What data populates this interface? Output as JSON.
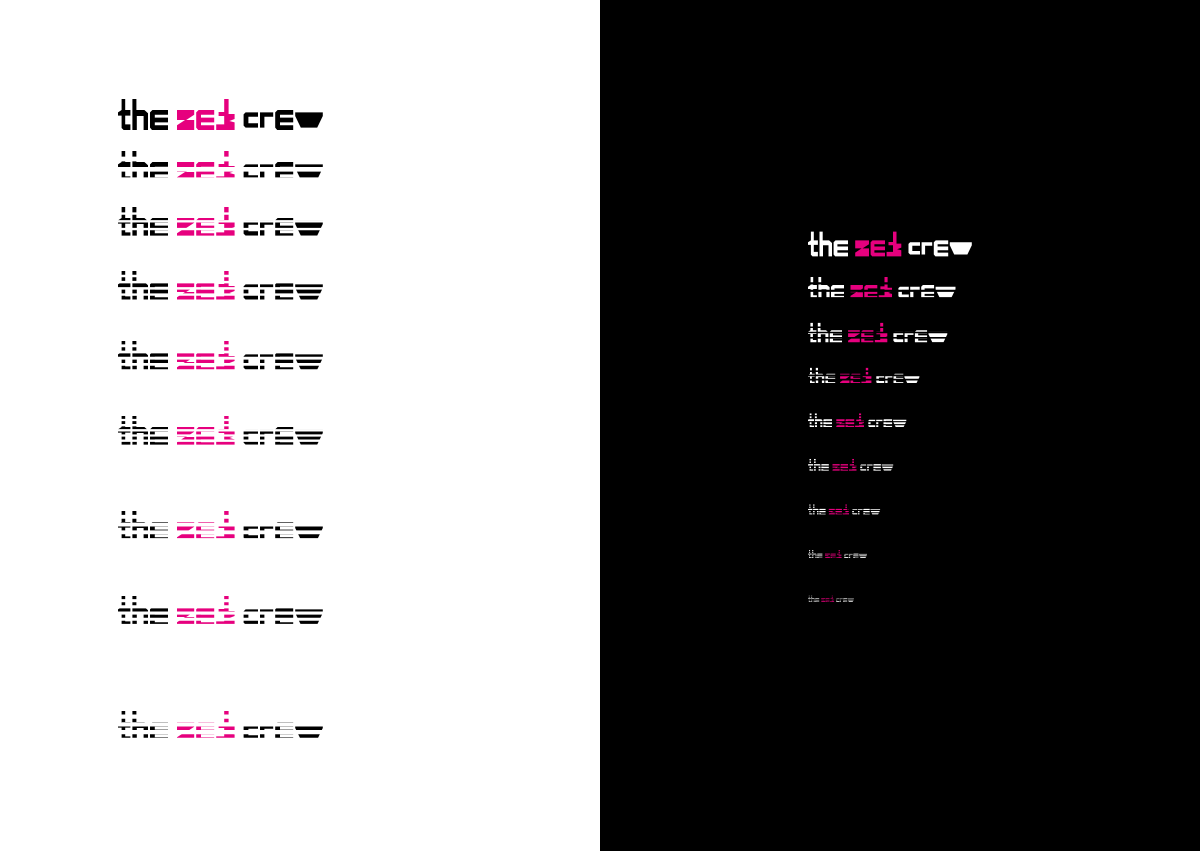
{
  "wordmark": {
    "words": [
      "the",
      "zek",
      "crew"
    ],
    "accent_word_index": 1
  },
  "colors": {
    "left_background": "#ffffff",
    "left_ink": "#000000",
    "right_background": "#000000",
    "right_ink": "#ffffff",
    "accent": "#e6007e"
  },
  "left_sequence": {
    "steps": 9,
    "stripe_counts": [
      1,
      3,
      4,
      5,
      5,
      6,
      4,
      5,
      4
    ],
    "stripe_fill": [
      1.0,
      0.55,
      0.7,
      0.6,
      0.55,
      0.55,
      0.5,
      0.5,
      0.45
    ],
    "exploded": [
      0,
      0,
      0.15,
      0.3,
      0.45,
      0.6,
      0.85,
      0.9,
      1.0
    ]
  },
  "right_sequence": {
    "steps": 9,
    "scale": [
      1.0,
      0.9,
      0.85,
      0.68,
      0.6,
      0.52,
      0.44,
      0.36,
      0.28
    ],
    "stripe_counts": [
      1,
      3,
      4,
      4,
      5,
      5,
      5,
      5,
      5
    ],
    "stripe_fill": [
      1.0,
      0.7,
      0.7,
      0.6,
      0.6,
      0.55,
      0.55,
      0.5,
      0.5
    ]
  }
}
